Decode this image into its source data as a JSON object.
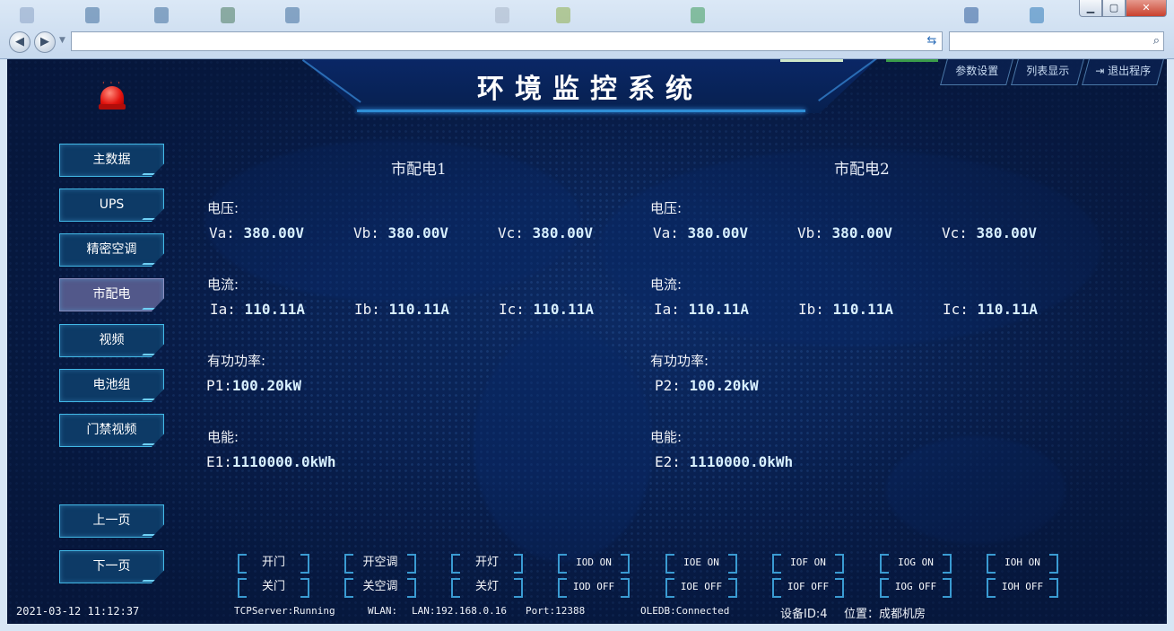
{
  "app": {
    "title": "环境监控系统",
    "top_buttons": [
      "参数设置",
      "列表显示",
      "退出程序"
    ]
  },
  "sidebar": {
    "items": [
      {
        "label": "主数据",
        "active": false
      },
      {
        "label": "UPS",
        "active": false
      },
      {
        "label": "精密空调",
        "active": false
      },
      {
        "label": "市配电",
        "active": true
      },
      {
        "label": "视频",
        "active": false
      },
      {
        "label": "电池组",
        "active": false
      },
      {
        "label": "门禁视频",
        "active": false
      }
    ],
    "prev_page": "上一页",
    "next_page": "下一页"
  },
  "panels": [
    {
      "title": "市配电1",
      "voltage_label": "电压:",
      "voltages": [
        {
          "key": "Va:",
          "value": "380.00V"
        },
        {
          "key": "Vb:",
          "value": "380.00V"
        },
        {
          "key": "Vc:",
          "value": "380.00V"
        }
      ],
      "current_label": "电流:",
      "currents": [
        {
          "key": "Ia:",
          "value": "110.11A"
        },
        {
          "key": "Ib:",
          "value": "110.11A"
        },
        {
          "key": "Ic:",
          "value": "110.11A"
        }
      ],
      "power_label": "有功功率:",
      "power": {
        "key": "P1:",
        "value": "100.20kW"
      },
      "energy_label": "电能:",
      "energy": {
        "key": "E1:",
        "value": "1110000.0kWh"
      }
    },
    {
      "title": "市配电2",
      "voltage_label": "电压:",
      "voltages": [
        {
          "key": "Va:",
          "value": "380.00V"
        },
        {
          "key": "Vb:",
          "value": "380.00V"
        },
        {
          "key": "Vc:",
          "value": "380.00V"
        }
      ],
      "current_label": "电流:",
      "currents": [
        {
          "key": "Ia:",
          "value": "110.11A"
        },
        {
          "key": "Ib:",
          "value": "110.11A"
        },
        {
          "key": "Ic:",
          "value": "110.11A"
        }
      ],
      "power_label": "有功功率:",
      "power": {
        "key": "P2:",
        "value": "100.20kW"
      },
      "energy_label": "电能:",
      "energy": {
        "key": "E2:",
        "value": "1110000.0kWh"
      }
    }
  ],
  "controls": {
    "row1": [
      "开门",
      "开空调",
      "开灯",
      "IOD ON",
      "IOE ON",
      "IOF ON",
      "IOG ON",
      "IOH ON"
    ],
    "row2": [
      "关门",
      "关空调",
      "关灯",
      "IOD OFF",
      "IOE OFF",
      "IOF OFF",
      "IOG OFF",
      "IOH OFF"
    ]
  },
  "footer": {
    "datetime": "2021-03-12 11:12:37",
    "tcp": "TCPServer:Running",
    "wlan": "WLAN:",
    "lan": "LAN:192.168.0.16",
    "port": "Port:12388",
    "oledb": "OLEDB:Connected",
    "device": "设备ID:4",
    "location": "位置：成都机房"
  },
  "colors": {
    "background": "#081d4a",
    "button_border": "#42b8e6",
    "active_button": "#52588a",
    "alarm": "#e2140f"
  }
}
